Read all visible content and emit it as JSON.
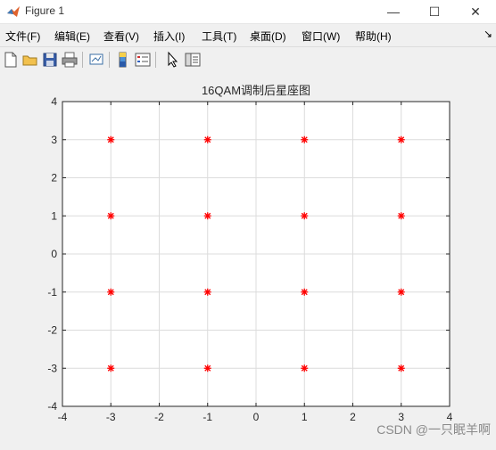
{
  "window": {
    "title": "Figure 1",
    "controls": {
      "minimize": "—",
      "maximize": "☐",
      "close": "✕"
    }
  },
  "menubar": {
    "items": [
      "文件(F)",
      "编辑(E)",
      "查看(V)",
      "插入(I)",
      "工具(T)",
      "桌面(D)",
      "窗口(W)",
      "帮助(H)"
    ],
    "more": "↘"
  },
  "toolbar": {
    "icons": [
      "new-figure-icon",
      "open-file-icon",
      "save-icon",
      "print-icon",
      "link-plot-icon",
      "insert-colorbar-icon",
      "insert-legend-icon",
      "edit-plot-arrow-icon",
      "property-editor-icon"
    ]
  },
  "watermark": "CSDN @一只眠羊啊",
  "colors": {
    "marker": "#ff0000",
    "grid": "#dcdcdc",
    "axes_bg": "#ffffff"
  },
  "chart_data": {
    "type": "scatter",
    "title": "16QAM调制后星座图",
    "xlabel": "",
    "ylabel": "",
    "xlim": [
      -4,
      4
    ],
    "ylim": [
      -4,
      4
    ],
    "xticks": [
      -4,
      -3,
      -2,
      -1,
      0,
      1,
      2,
      3,
      4
    ],
    "yticks": [
      -4,
      -3,
      -2,
      -1,
      0,
      1,
      2,
      3,
      4
    ],
    "grid": true,
    "marker": "*",
    "marker_color": "#ff0000",
    "points": [
      {
        "x": -3,
        "y": 3
      },
      {
        "x": -1,
        "y": 3
      },
      {
        "x": 1,
        "y": 3
      },
      {
        "x": 3,
        "y": 3
      },
      {
        "x": -3,
        "y": 1
      },
      {
        "x": -1,
        "y": 1
      },
      {
        "x": 1,
        "y": 1
      },
      {
        "x": 3,
        "y": 1
      },
      {
        "x": -3,
        "y": -1
      },
      {
        "x": -1,
        "y": -1
      },
      {
        "x": 1,
        "y": -1
      },
      {
        "x": 3,
        "y": -1
      },
      {
        "x": -3,
        "y": -3
      },
      {
        "x": -1,
        "y": -3
      },
      {
        "x": 1,
        "y": -3
      },
      {
        "x": 3,
        "y": -3
      }
    ]
  }
}
